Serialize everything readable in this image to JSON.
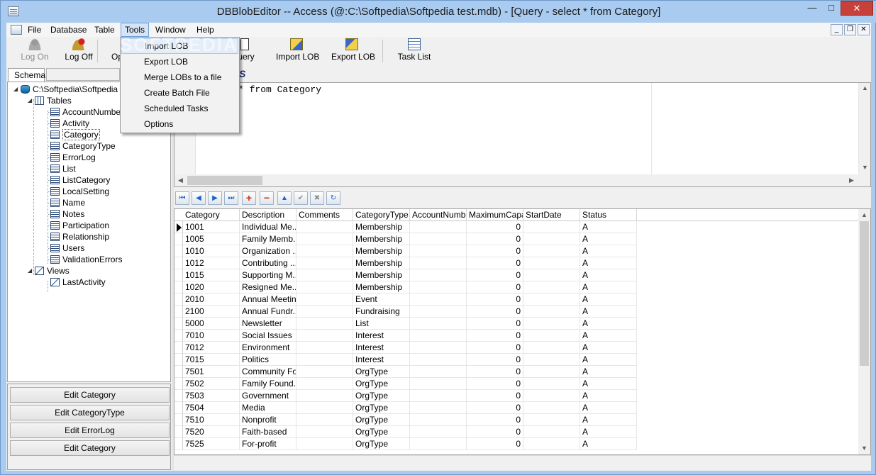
{
  "window": {
    "title": "DBBlobEditor -- Access (@:C:\\Softpedia\\Softpedia test.mdb) - [Query - select * from Category]",
    "controls": {
      "minimize": "—",
      "maximize": "□",
      "close": "✕"
    }
  },
  "menubar": {
    "items": [
      "File",
      "Database",
      "Table",
      "Tools",
      "Window",
      "Help"
    ],
    "open_menu": "Tools",
    "mdi_controls": {
      "minimize": "_",
      "restore": "❐",
      "close": "✕"
    }
  },
  "toolbar": {
    "log_on": "Log On",
    "log_off": "Log Off",
    "open_partial": "Op",
    "query_partial": "uery",
    "import_lob": "Import LOB",
    "export_lob": "Export LOB",
    "task_list": "Task List"
  },
  "tools_menu": {
    "items": [
      "Import LOB",
      "Export LOB",
      "Merge LOBs to a file",
      "Create Batch File",
      "Scheduled Tasks",
      "Options"
    ],
    "hot_index": 0
  },
  "watermark": "SOFTPEDIA",
  "schema": {
    "tab_label": "Schema",
    "root": "C:\\Softpedia\\Softpedia",
    "tables_label": "Tables",
    "tables": [
      "AccountNumber",
      "Activity",
      "Category",
      "CategoryType",
      "ErrorLog",
      "List",
      "ListCategory",
      "LocalSetting",
      "Name",
      "Notes",
      "Participation",
      "Relationship",
      "Users",
      "ValidationErrors"
    ],
    "selected_table": "Category",
    "views_label": "Views",
    "views": [
      "LastActivity"
    ]
  },
  "quick_edit": [
    "Edit Category",
    "Edit CategoryType",
    "Edit ErrorLog",
    "Edit Category"
  ],
  "sql": {
    "visible_text": "* from Category"
  },
  "navigator": [
    "⏮",
    "◀",
    "▶",
    "⏭",
    "+",
    "−",
    "▲",
    "✔",
    "✖",
    "↻"
  ],
  "grid": {
    "columns": [
      "Category",
      "Description",
      "Comments",
      "CategoryType",
      "AccountNumber",
      "MaximumCapa...",
      "StartDate",
      "Status"
    ],
    "rows": [
      [
        "1001",
        "Individual Me...",
        "",
        "Membership",
        "",
        "0",
        "",
        "A"
      ],
      [
        "1005",
        "Family Memb...",
        "",
        "Membership",
        "",
        "0",
        "",
        "A"
      ],
      [
        "1010",
        "Organization ...",
        "",
        "Membership",
        "",
        "0",
        "",
        "A"
      ],
      [
        "1012",
        "Contributing ...",
        "",
        "Membership",
        "",
        "0",
        "",
        "A"
      ],
      [
        "1015",
        "Supporting M...",
        "",
        "Membership",
        "",
        "0",
        "",
        "A"
      ],
      [
        "1020",
        "Resigned Me...",
        "",
        "Membership",
        "",
        "0",
        "",
        "A"
      ],
      [
        "2010",
        "Annual Meeting",
        "",
        "Event",
        "",
        "0",
        "",
        "A"
      ],
      [
        "2100",
        "Annual Fundr...",
        "",
        "Fundraising",
        "",
        "0",
        "",
        "A"
      ],
      [
        "5000",
        "Newsletter",
        "",
        "List",
        "",
        "0",
        "",
        "A"
      ],
      [
        "7010",
        "Social Issues",
        "",
        "Interest",
        "",
        "0",
        "",
        "A"
      ],
      [
        "7012",
        "Environment",
        "",
        "Interest",
        "",
        "0",
        "",
        "A"
      ],
      [
        "7015",
        "Politics",
        "",
        "Interest",
        "",
        "0",
        "",
        "A"
      ],
      [
        "7501",
        "Community Fo...",
        "",
        "OrgType",
        "",
        "0",
        "",
        "A"
      ],
      [
        "7502",
        "Family Found...",
        "",
        "OrgType",
        "",
        "0",
        "",
        "A"
      ],
      [
        "7503",
        "Government",
        "",
        "OrgType",
        "",
        "0",
        "",
        "A"
      ],
      [
        "7504",
        "Media",
        "",
        "OrgType",
        "",
        "0",
        "",
        "A"
      ],
      [
        "7510",
        "Nonprofit",
        "",
        "OrgType",
        "",
        "0",
        "",
        "A"
      ],
      [
        "7520",
        "Faith-based",
        "",
        "OrgType",
        "",
        "0",
        "",
        "A"
      ],
      [
        "7525",
        "For-profit",
        "",
        "OrgType",
        "",
        "0",
        "",
        "A"
      ]
    ],
    "current_row": 0
  },
  "colors": {
    "frame": "#a9cbf0",
    "close_button": "#c7403a",
    "menu_highlight": "#d5e5f7",
    "nav_blue": "#1f63c4",
    "nav_red": "#cc2f0d"
  }
}
